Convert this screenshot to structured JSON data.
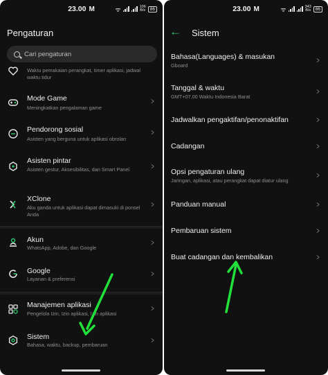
{
  "status_bar": {
    "time": "23.00",
    "speed_top": "106",
    "speed_bottom": "B/s",
    "battery": "86",
    "speed_top_right": "343",
    "speed_bottom_right": "B/s",
    "battery_right": "86"
  },
  "left_screen": {
    "title": "Pengaturan",
    "search": {
      "placeholder": "Cari pengaturan"
    },
    "items": [
      {
        "icon": "heart-icon",
        "title": "",
        "subtitle": "Waktu pemakaian perangkat, timer aplikasi, jadwal waktu tidur"
      },
      {
        "icon": "gamepad-icon",
        "title": "Mode Game",
        "subtitle": "Meningkatkan pengalaman game"
      },
      {
        "icon": "chat-icon",
        "title": "Pendorong sosial",
        "subtitle": "Asisten yang berguna untuk aplikasi obrolan"
      },
      {
        "icon": "assistant-icon",
        "title": "Asisten pintar",
        "subtitle": "Asisten gestur, Aksesibilitas, dan Smart Panel"
      },
      {
        "icon": "xclone-icon",
        "title": "XClone",
        "subtitle": "Aku ganda untuk aplikasi dapat dimasuki di ponsel Anda"
      },
      {
        "icon": "account-icon",
        "title": "Akun",
        "subtitle": "WhatsApp, Adobe, dan Google"
      },
      {
        "icon": "google-icon",
        "title": "Google",
        "subtitle": "Layanan & preferensi"
      },
      {
        "icon": "apps-icon",
        "title": "Manajemen aplikasi",
        "subtitle": "Pengelola Izin, Izin aplikasi, Izin aplikasi"
      },
      {
        "icon": "system-icon",
        "title": "Sistem",
        "subtitle": "Bahasa, waktu, backup, pembaruan"
      }
    ]
  },
  "right_screen": {
    "title": "Sistem",
    "items": [
      {
        "title": "Bahasa(Languages) & masukan",
        "subtitle": "Gboard"
      },
      {
        "title": "Tanggal & waktu",
        "subtitle": "GMT+07.00 Waktu Indonesia Barat"
      },
      {
        "title": "Jadwalkan pengaktifan/penonaktifan",
        "subtitle": ""
      },
      {
        "title": "Cadangan",
        "subtitle": ""
      },
      {
        "title": "Opsi pengaturan ulang",
        "subtitle": "Jaringan, aplikasi, atau perangkat dapat diatur ulang"
      },
      {
        "title": "Panduan manual",
        "subtitle": ""
      },
      {
        "title": "Pembaruan sistem",
        "subtitle": ""
      },
      {
        "title": "Buat cadangan dan kembalikan",
        "subtitle": ""
      }
    ]
  },
  "colors": {
    "background": "#111111",
    "accent": "#2ecc71",
    "annotation_arrow": "#22e03a"
  }
}
